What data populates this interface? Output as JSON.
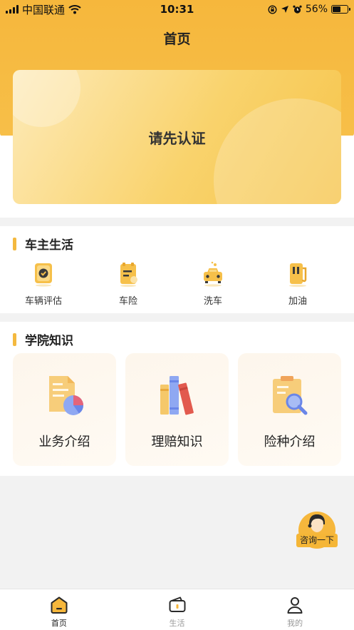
{
  "status_bar": {
    "carrier": "中国联通",
    "time": "10:31",
    "battery": "56%"
  },
  "header": {
    "title": "首页"
  },
  "banner": {
    "text": "请先认证"
  },
  "car_life": {
    "title": "车主生活",
    "items": [
      {
        "label": "车辆评估",
        "icon": "vehicle-assessment-icon"
      },
      {
        "label": "车险",
        "icon": "car-insurance-icon"
      },
      {
        "label": "洗车",
        "icon": "car-wash-icon"
      },
      {
        "label": "加油",
        "icon": "fuel-pump-icon"
      }
    ]
  },
  "academy": {
    "title": "学院知识",
    "cards": [
      {
        "label": "业务介绍",
        "icon": "business-document-icon"
      },
      {
        "label": "理赔知识",
        "icon": "books-icon"
      },
      {
        "label": "险种介绍",
        "icon": "clipboard-search-icon"
      }
    ]
  },
  "consult": {
    "label": "咨询一下"
  },
  "tabbar": {
    "items": [
      {
        "label": "首页",
        "icon": "home-icon",
        "active": true
      },
      {
        "label": "生活",
        "icon": "wallet-icon",
        "active": false
      },
      {
        "label": "我的",
        "icon": "user-icon",
        "active": false
      }
    ]
  },
  "colors": {
    "accent": "#f6b73c",
    "text": "#222222",
    "background": "#f2f2f2"
  }
}
